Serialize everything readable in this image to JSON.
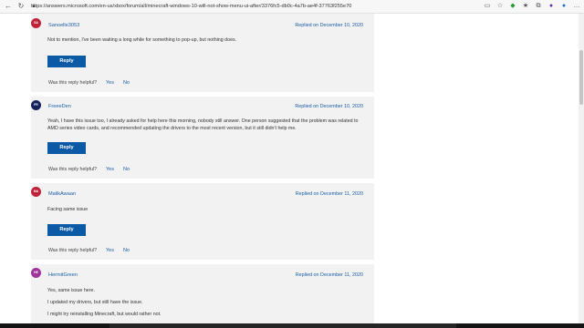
{
  "browser": {
    "url": "https://answers.microsoft.com/en-us/xbox/forum/all/minecraft-windows-10-will-not-show-menu-ui-after/3376fc5-db0c-4a7b-ae4f-37763f255e70"
  },
  "helpful_prompt": "Was this reply helpful?",
  "replies": [
    {
      "avatar_initials": "SA",
      "avatar_color": "#c0223a",
      "username": "Sanoelle3053",
      "replied": "Replied on December 10, 2020",
      "paragraphs": [
        "Not to mention, I've been waiting a long while for something to pop-up, but nothing does."
      ],
      "reply_label": "Reply",
      "yes": "Yes",
      "no": "No"
    },
    {
      "avatar_initials": "FR",
      "avatar_color": "#14235a",
      "username": "FreeeDen",
      "replied": "Replied on December 10, 2020",
      "paragraphs": [
        "Yeah, I have this issue too, I already asked for help here this morning, nobody still answer. One person suggested that the problem was related to AMD series video cards, and recommended updating the drivers to the most recent version, but it still didn't help me."
      ],
      "reply_label": "Reply",
      "yes": "Yes",
      "no": "No"
    },
    {
      "avatar_initials": "MA",
      "avatar_color": "#c0223a",
      "username": "MalikAwaan",
      "replied": "Replied on December 11, 2020",
      "paragraphs": [
        "Facing same issue"
      ],
      "reply_label": "Reply",
      "yes": "Yes",
      "no": "No"
    },
    {
      "avatar_initials": "HE",
      "avatar_color": "#a0339a",
      "username": "HermitGreen",
      "replied": "Replied on December 11, 2020",
      "paragraphs": [
        "Yes, same issue here.",
        "I updated my drivers, but still have the issue.",
        "I might try reinstalling Minecraft, but would rather not."
      ]
    }
  ]
}
